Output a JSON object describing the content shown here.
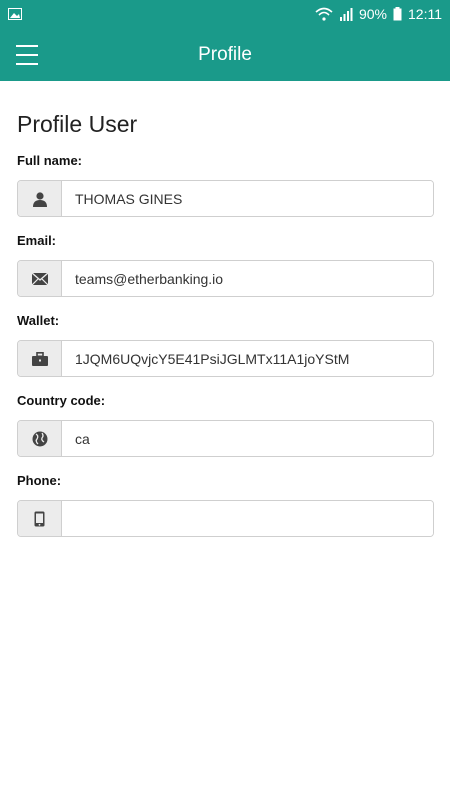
{
  "status_bar": {
    "battery": "90%",
    "time": "12:11",
    "icons": [
      "image-icon",
      "wifi-icon",
      "signal-icon",
      "battery-icon"
    ]
  },
  "app_bar": {
    "title": "Profile",
    "menu_icon": "hamburger-menu-icon"
  },
  "page": {
    "title": "Profile User"
  },
  "fields": [
    {
      "label": "Full name:",
      "value": "THOMAS GINES",
      "icon": "user-icon"
    },
    {
      "label": "Email:",
      "value": "teams@etherbanking.io",
      "icon": "envelope-icon"
    },
    {
      "label": "Wallet:",
      "value": "1JQM6UQvjcY5E41PsiJGLMTx11A1joYStM",
      "icon": "briefcase-icon"
    },
    {
      "label": "Country code:",
      "value": "ca",
      "icon": "globe-icon"
    },
    {
      "label": "Phone:",
      "value": "",
      "icon": "mobile-phone-icon"
    }
  ],
  "colors": {
    "primary": "#1a9a8a",
    "addon_bg": "#ececec",
    "border": "#cfcfcf"
  }
}
